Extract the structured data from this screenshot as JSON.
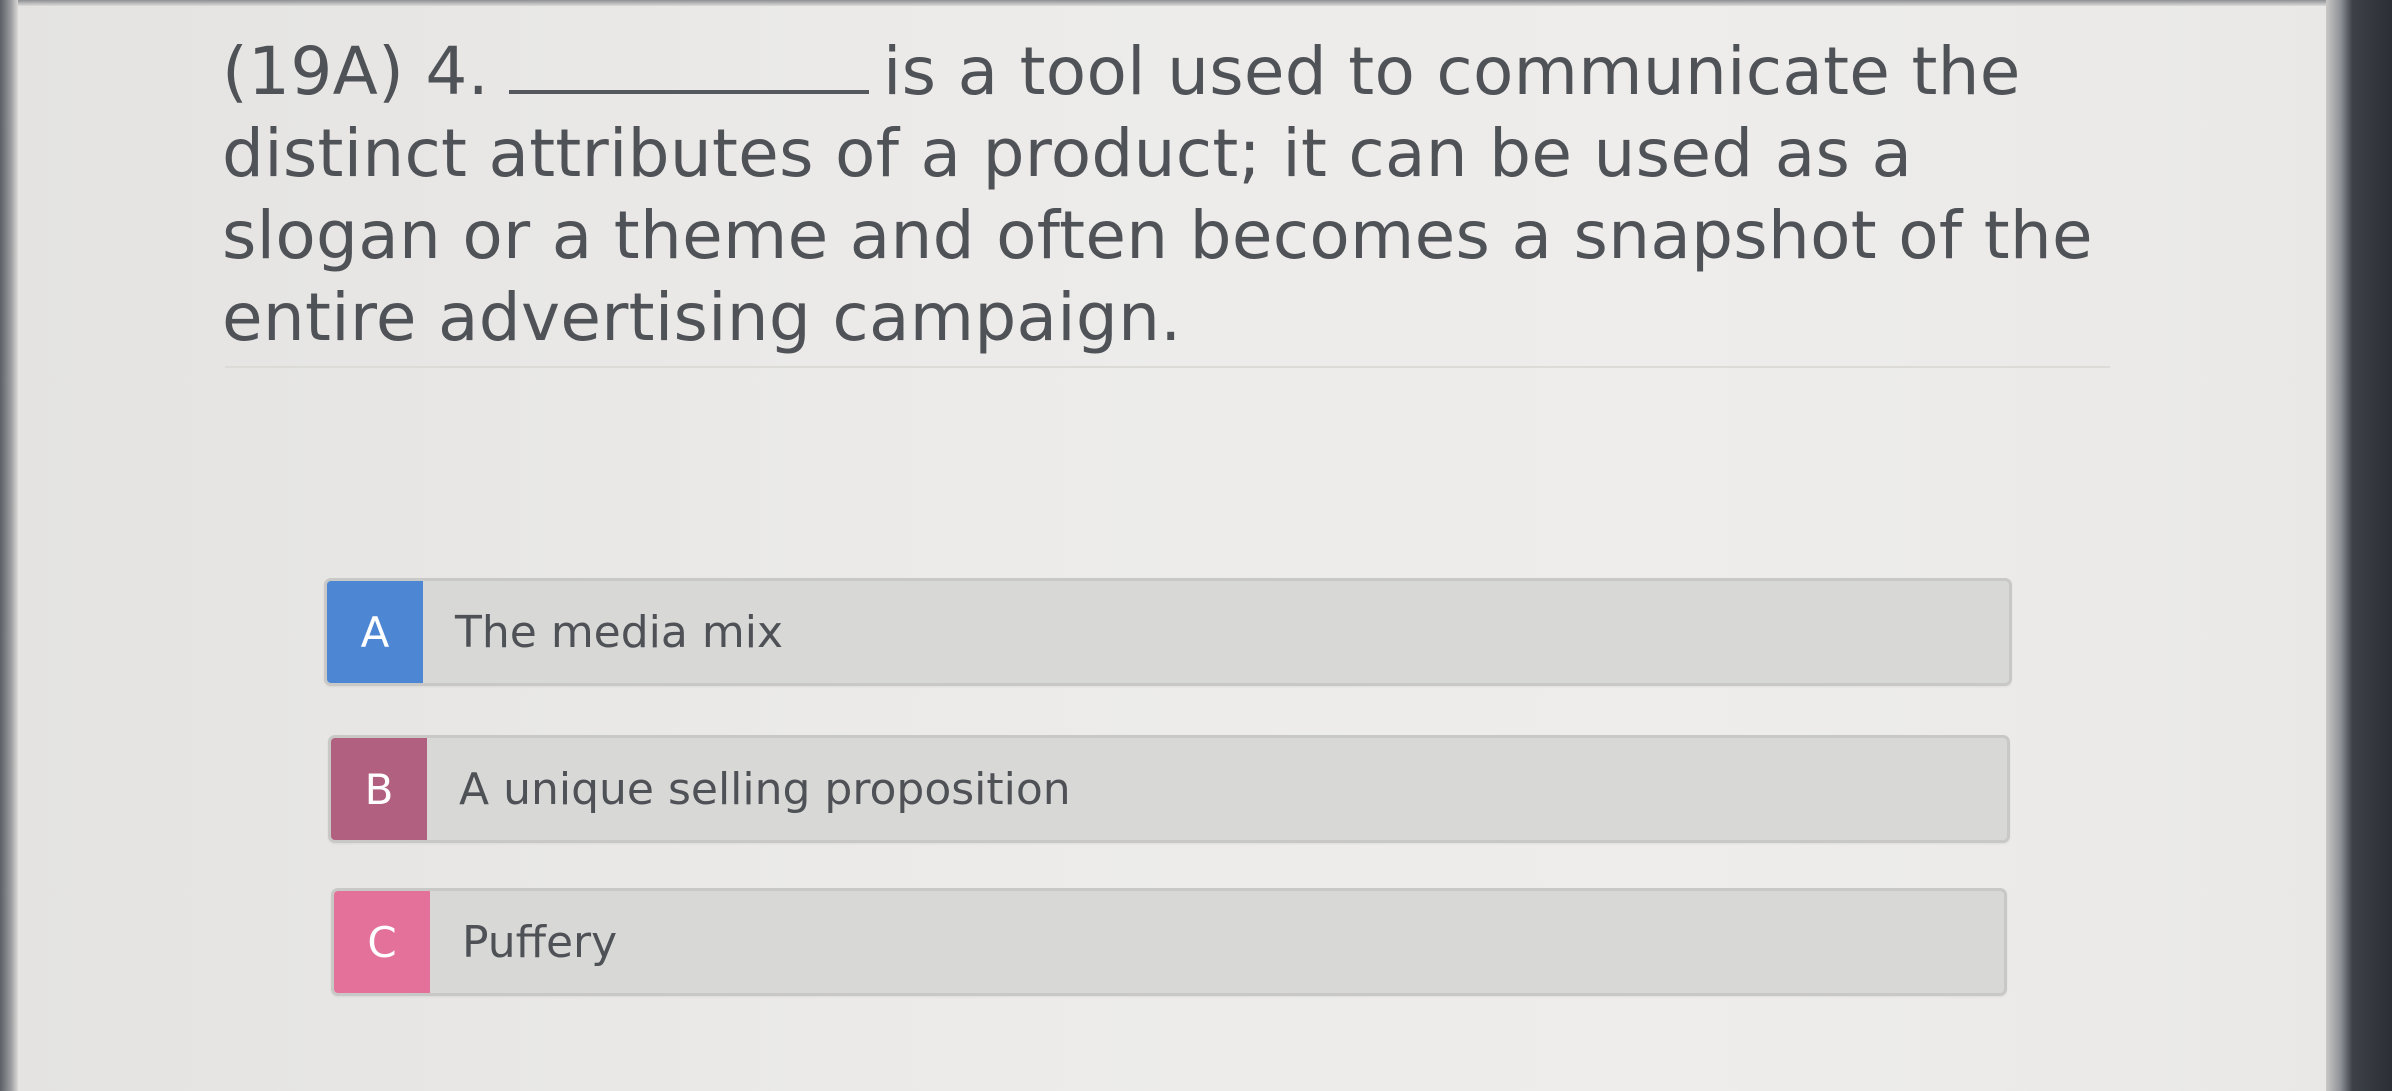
{
  "question": {
    "prefix": "(19A) 4.",
    "text": "is a tool used to communicate the distinct attributes of a product; it can be used as a slogan or a theme and often becomes a snapshot of the entire advertising campaign."
  },
  "options": [
    {
      "letter": "A",
      "label": "The media mix",
      "color": "#4d87d4"
    },
    {
      "letter": "B",
      "label": "A unique selling proposition",
      "color": "#b1607f"
    },
    {
      "letter": "C",
      "label": "Puffery",
      "color": "#e3719a"
    }
  ]
}
